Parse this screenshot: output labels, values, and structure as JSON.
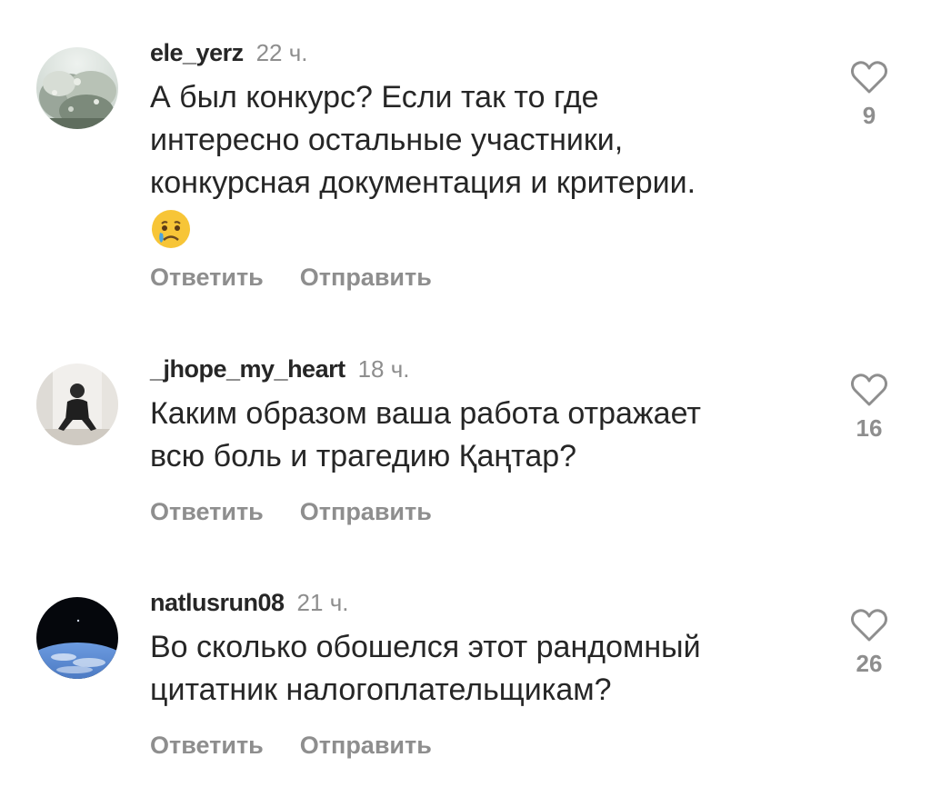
{
  "comments": [
    {
      "username": "ele_yerz",
      "time": "22 ч.",
      "text_lines": [
        "А был конкурс? Если так то где",
        "интересно остальные участники,",
        "конкурсная документация и критерии."
      ],
      "emoji": "crying-face",
      "reply_label": "Ответить",
      "send_label": "Отправить",
      "likes": "9"
    },
    {
      "username": "_jhope_my_heart",
      "time": "18 ч.",
      "text_lines": [
        "Каким образом ваша работа отражает",
        "всю боль и трагедию Қаңтар?"
      ],
      "reply_label": "Ответить",
      "send_label": "Отправить",
      "likes": "16"
    },
    {
      "username": "natlusrun08",
      "time": "21 ч.",
      "text_lines": [
        "Во сколько обошелся этот рандомный",
        "цитатник налогоплательщикам?"
      ],
      "reply_label": "Ответить",
      "send_label": "Отправить",
      "likes": "26"
    }
  ],
  "icons": {
    "like": "heart-outline-icon"
  },
  "colors": {
    "primary_text": "#262626",
    "secondary_text": "#8e8e8e"
  }
}
